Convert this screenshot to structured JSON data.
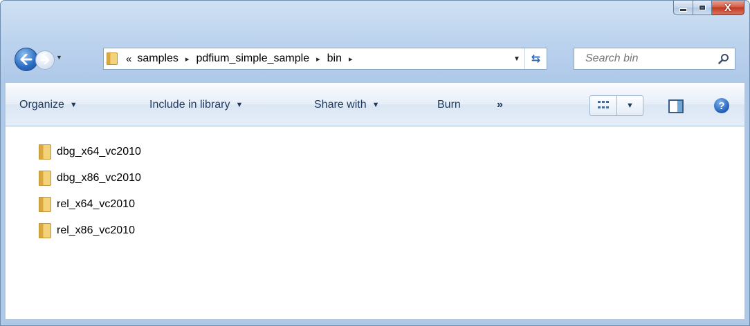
{
  "window": {
    "controls": {
      "minimize_icon": "minimize-icon",
      "maximize_icon": "maximize-icon",
      "close_glyph": "X"
    }
  },
  "navigation": {
    "back_icon": "back-arrow-icon",
    "forward_icon": "forward-arrow-icon",
    "breadcrumb": {
      "overflow": "«",
      "segments": [
        "samples",
        "pdfium_simple_sample",
        "bin"
      ],
      "separator": "▸"
    },
    "search": {
      "placeholder": "Search bin"
    }
  },
  "command_bar": {
    "organize": "Organize",
    "include_in_library": "Include in library",
    "share_with": "Share with",
    "burn": "Burn",
    "more": "»",
    "help": "?"
  },
  "files": [
    {
      "name": "dbg_x64_vc2010",
      "type": "folder"
    },
    {
      "name": "dbg_x86_vc2010",
      "type": "folder"
    },
    {
      "name": "rel_x64_vc2010",
      "type": "folder"
    },
    {
      "name": "rel_x86_vc2010",
      "type": "folder"
    }
  ],
  "colors": {
    "chrome": "#bcd3ee",
    "command_text": "#1e395b",
    "close_button": "#c0391f"
  }
}
